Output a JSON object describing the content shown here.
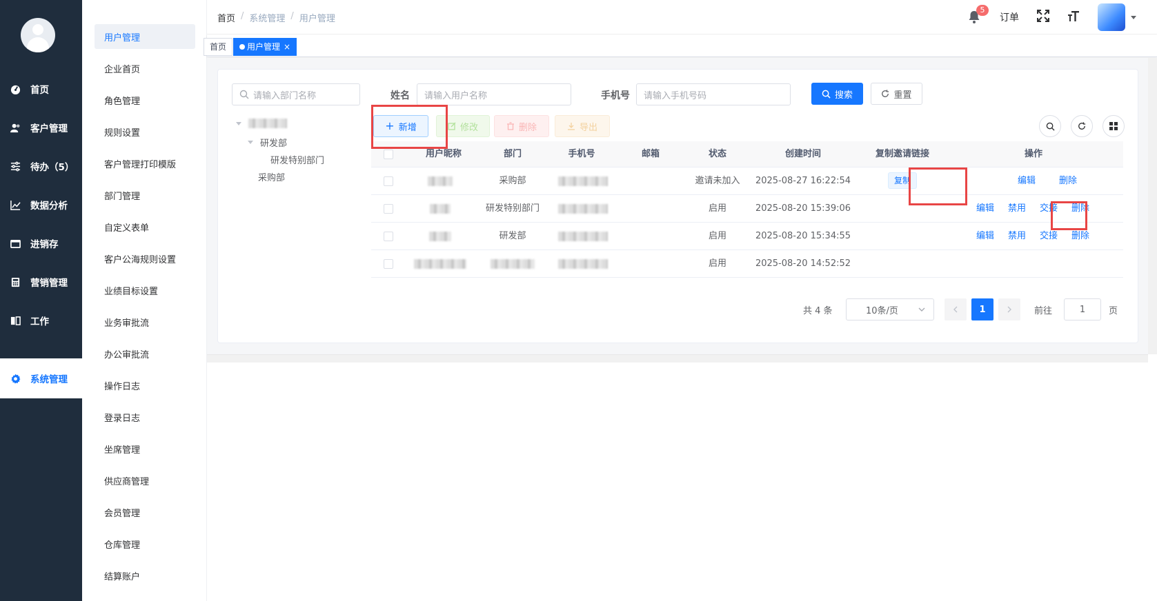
{
  "rail": {
    "items": [
      {
        "label": "首页",
        "icon": "dashboard-icon"
      },
      {
        "label": "客户管理",
        "icon": "users-icon"
      },
      {
        "label": "待办（5）",
        "icon": "sliders-icon"
      },
      {
        "label": "数据分析",
        "icon": "chart-line-icon"
      },
      {
        "label": "进销存",
        "icon": "folder-icon"
      },
      {
        "label": "营销管理",
        "icon": "calculator-icon"
      },
      {
        "label": "工作",
        "icon": "book-icon"
      },
      {
        "label": "系统管理",
        "icon": "gear-icon"
      }
    ],
    "active_index": 7
  },
  "submenu": {
    "items": [
      "用户管理",
      "企业首页",
      "角色管理",
      "规则设置",
      "客户管理打印模版",
      "部门管理",
      "自定义表单",
      "客户公海规则设置",
      "业绩目标设置",
      "业务审批流",
      "办公审批流",
      "操作日志",
      "登录日志",
      "坐席管理",
      "供应商管理",
      "会员管理",
      "仓库管理",
      "结算账户"
    ],
    "active_index": 0
  },
  "navbar": {
    "breadcrumb": [
      "首页",
      "系统管理",
      "用户管理"
    ],
    "sep": "/",
    "notification_count": "5",
    "orders_label": "订单"
  },
  "tags": {
    "home": "首页",
    "active": "用户管理",
    "close": "×"
  },
  "search": {
    "dept_placeholder": "请输入部门名称",
    "name_label": "姓名",
    "name_placeholder": "请输入用户名称",
    "phone_label": "手机号",
    "phone_placeholder": "请输入手机号码",
    "search_label": "搜索",
    "reset_label": "重置"
  },
  "tree": {
    "children": [
      {
        "label": "研发部",
        "children": [
          {
            "label": "研发特别部门"
          }
        ]
      },
      {
        "label": "采购部"
      }
    ]
  },
  "toolbar": {
    "add": "新增",
    "edit": "修改",
    "delete": "删除",
    "export": "导出"
  },
  "table": {
    "headers": [
      "用户昵称",
      "部门",
      "手机号",
      "邮箱",
      "状态",
      "创建时间",
      "复制邀请链接",
      "操作"
    ],
    "rows": [
      {
        "dept": "采购部",
        "status": "邀请未加入",
        "created": "2025-08-27 16:22:54",
        "copy": "复制",
        "actions": [
          "编辑",
          "删除"
        ]
      },
      {
        "dept": "研发特别部门",
        "status": "启用",
        "created": "2025-08-20 15:39:06",
        "copy": "",
        "actions": [
          "编辑",
          "禁用",
          "交接",
          "删除"
        ]
      },
      {
        "dept": "研发部",
        "status": "启用",
        "created": "2025-08-20 15:34:55",
        "copy": "",
        "actions": [
          "编辑",
          "禁用",
          "交接",
          "删除"
        ]
      },
      {
        "dept": "",
        "status": "启用",
        "created": "2025-08-20 14:52:52",
        "copy": "",
        "actions": []
      }
    ]
  },
  "pagination": {
    "total": "共 4 条",
    "page_size": "10条/页",
    "current": "1",
    "goto_label": "前往",
    "goto_value": "1",
    "page_suffix": "页"
  },
  "colors": {
    "primary": "#1677ff",
    "sidebar_bg": "#1f2d3d",
    "highlight": "#e84545"
  }
}
